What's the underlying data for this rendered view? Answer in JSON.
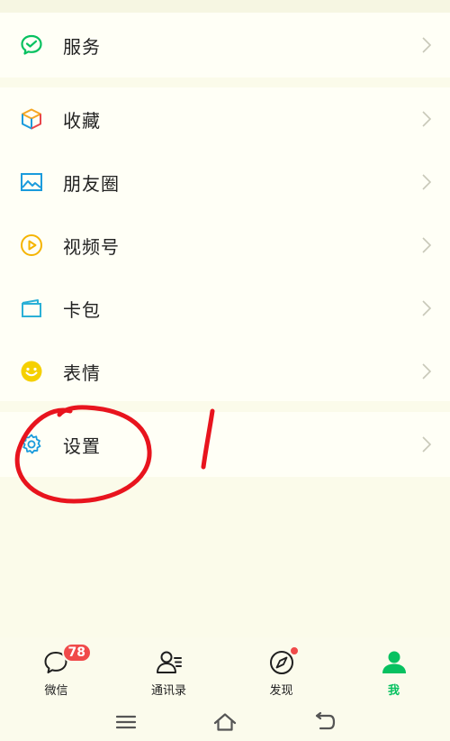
{
  "menu": {
    "services": "服务",
    "favorites": "收藏",
    "moments": "朋友圈",
    "channels": "视频号",
    "cards": "卡包",
    "stickers": "表情",
    "settings": "设置"
  },
  "annotation": {
    "mark": "1",
    "circle_color": "#e8141e"
  },
  "tabs": {
    "chats": {
      "label": "微信",
      "badge": "78"
    },
    "contacts": {
      "label": "通讯录"
    },
    "discover": {
      "label": "发现"
    },
    "me": {
      "label": "我"
    }
  },
  "colors": {
    "accent": "#07c160",
    "badge": "#f04a4a",
    "icon_blue": "#1a9bdc",
    "icon_yellow": "#f5c518"
  }
}
